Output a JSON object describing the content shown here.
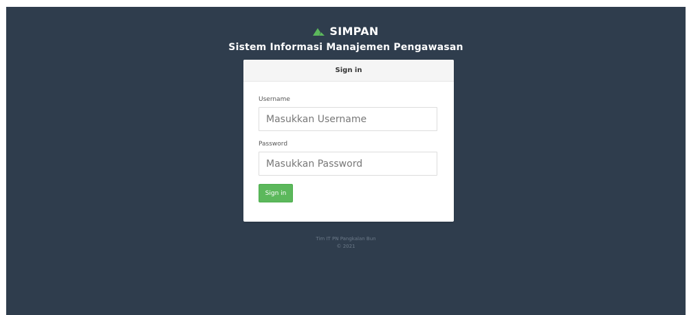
{
  "brand": {
    "logo_icon": "mountain-icon",
    "name": "SIMPAN",
    "subtitle": "Sistem Informasi Manajemen Pengawasan"
  },
  "card": {
    "header": "Sign in",
    "username": {
      "label": "Username",
      "placeholder": "Masukkan Username",
      "value": ""
    },
    "password": {
      "label": "Password",
      "placeholder": "Masukkan Password",
      "value": ""
    },
    "submit_label": "Sign in"
  },
  "footer": {
    "line1": "Tim IT PN Pangkalan Bun",
    "line2": "© 2021"
  },
  "colors": {
    "background": "#2f3d4d",
    "accent": "#5cb85c",
    "logo": "#5cb85c"
  }
}
